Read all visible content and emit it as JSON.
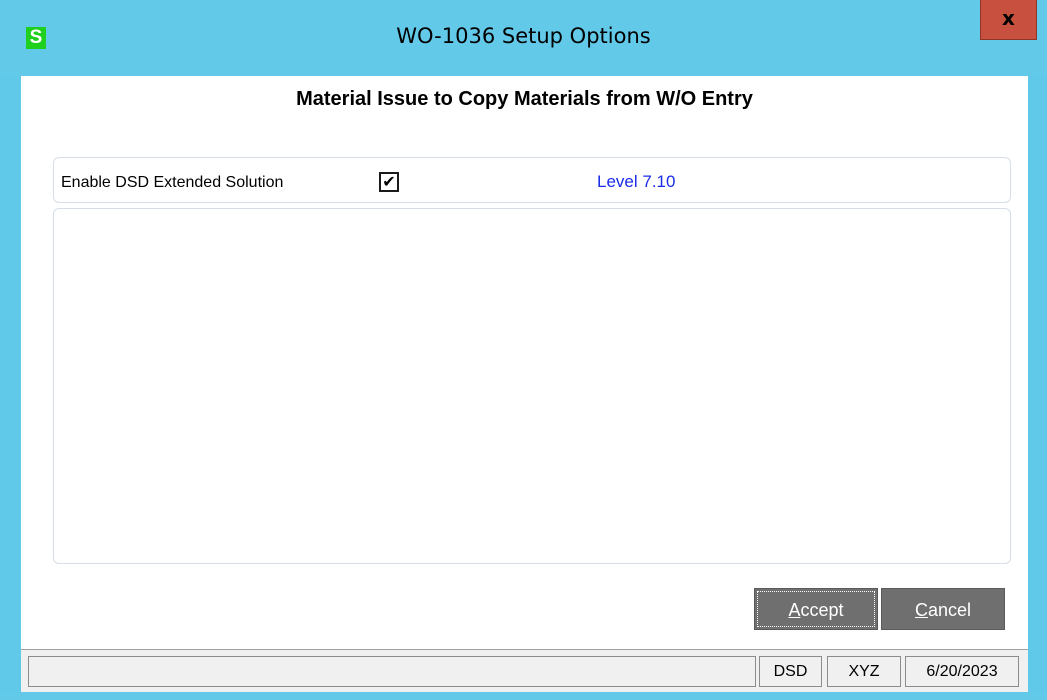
{
  "window": {
    "icon_letter": "S",
    "title": "WO-1036 Setup Options",
    "close_label": "x"
  },
  "main": {
    "heading": "Material Issue to Copy Materials from W/O Entry",
    "options": {
      "enable_label": "Enable DSD Extended Solution",
      "enable_checked": true,
      "check_mark": "✔",
      "level_label": "Level  7.10"
    }
  },
  "buttons": {
    "accept_access_key": "A",
    "accept_rest": "ccept",
    "cancel_access_key": "C",
    "cancel_rest": "ancel"
  },
  "statusbar": {
    "message": "",
    "company_code": "DSD",
    "user_code": "XYZ",
    "date": "6/20/2023"
  },
  "colors": {
    "titlebar": "#62c9e9",
    "close_button": "#c8503e",
    "app_icon": "#1fd01f",
    "level_text": "#1a2be8",
    "button_bg": "#6f6f6f"
  }
}
